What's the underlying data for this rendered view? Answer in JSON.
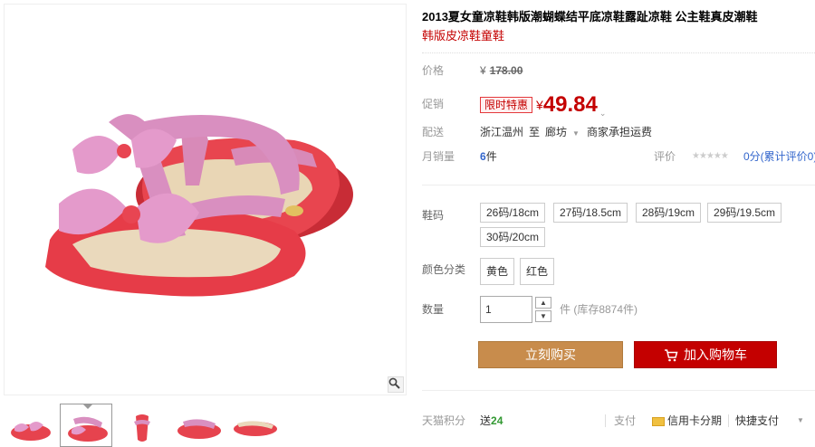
{
  "product": {
    "title": "2013夏女童凉鞋韩版潮蝴蝶结平底凉鞋露趾凉鞋 公主鞋真皮潮鞋",
    "subtitle": "韩版皮凉鞋童鞋"
  },
  "price": {
    "label": "价格",
    "currency": "¥",
    "original": "178.00"
  },
  "promo": {
    "label": "促销",
    "badge": "限时特惠",
    "currency": "¥",
    "price": "49.84"
  },
  "shipping": {
    "label": "配送",
    "from": "浙江温州",
    "to_word": "至",
    "dest": "廊坊",
    "fee": "商家承担运费"
  },
  "sales": {
    "label": "月销量",
    "count": "6",
    "unit": "件",
    "rating_label": "评价",
    "stars": "★★★★★",
    "rating_text": "0分(累计评价0)"
  },
  "sizes": {
    "label": "鞋码",
    "options": [
      "26码/18cm",
      "27码/18.5cm",
      "28码/19cm",
      "29码/19.5cm",
      "30码/20cm"
    ]
  },
  "colors": {
    "label": "颜色分类",
    "options": [
      "黄色",
      "红色"
    ]
  },
  "quantity": {
    "label": "数量",
    "value": "1",
    "stock_text": "件 (库存8874件)"
  },
  "buttons": {
    "buy": "立刻购买",
    "cart": "加入购物车"
  },
  "footer": {
    "points_label": "天猫积分",
    "points_prefix": "送",
    "points_value": "24",
    "pay_label": "支付",
    "credit": "信用卡分期",
    "quick_pay": "快捷支付"
  },
  "colors_theme": {
    "price_red": "#c40000",
    "buy_btn": "#c88c4c",
    "cart_btn": "#c40000",
    "shoe_pink": "#d88ab8",
    "shoe_red": "#e8454f"
  },
  "icons": [
    "zoom-icon",
    "cart-icon",
    "credit-card-icon",
    "chevron-down-icon"
  ]
}
